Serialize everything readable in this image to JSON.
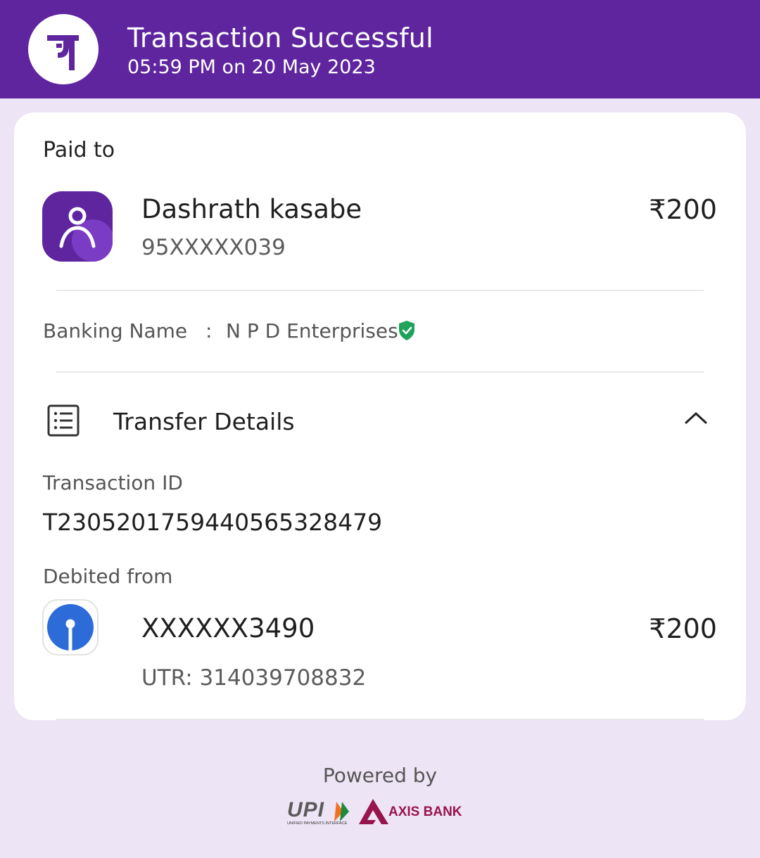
{
  "header": {
    "title": "Transaction Successful",
    "datetime": "05:59 PM on 20 May 2023",
    "logo_icon": "phonepe-logo-icon",
    "background": "#5f259f"
  },
  "paid_to": {
    "label": "Paid to",
    "name": "Dashrath kasabe",
    "phone": "95XXXXX039",
    "amount": "₹200",
    "icon": "user-avatar-icon"
  },
  "banking": {
    "label": "Banking Name",
    "separator": ":",
    "value": "N P D Enterprises",
    "verified_icon": "shield-check-icon",
    "verified_color": "#1fa35b"
  },
  "transfer_details": {
    "title": "Transfer Details",
    "icon": "receipt-list-icon",
    "toggle_icon": "chevron-up-icon",
    "transaction_id_label": "Transaction ID",
    "transaction_id": "T2305201759440565328479",
    "debited_from_label": "Debited from",
    "account": "XXXXXX3490",
    "amount": "₹200",
    "utr": "UTR: 314039708832",
    "bank_icon": "sbi-bank-icon"
  },
  "footer": {
    "powered_by": "Powered by",
    "upi_logo_text": "UPI",
    "upi_tagline": "UNIFIED PAYMENTS INTERFACE",
    "axis_logo_text": "AXIS BANK",
    "axis_color": "#97144d"
  }
}
